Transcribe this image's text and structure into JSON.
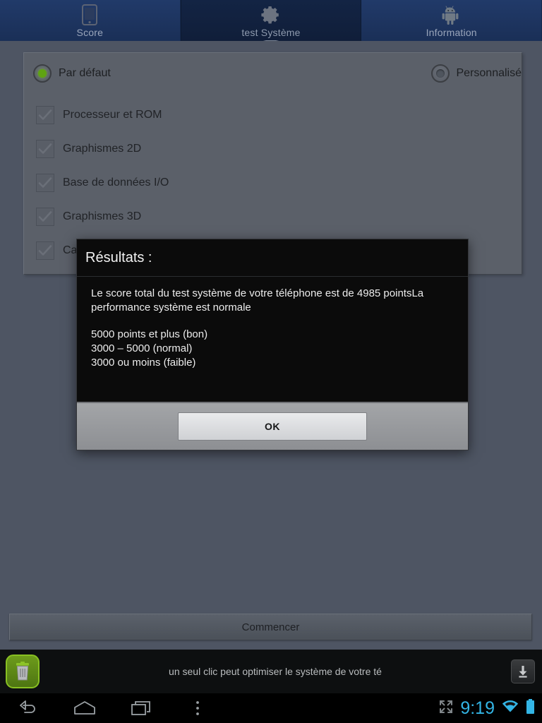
{
  "tabs": [
    {
      "label": "Score",
      "icon": "phone-icon",
      "selected": false
    },
    {
      "label": "test Système",
      "icon": "gear-icon",
      "selected": true
    },
    {
      "label": "Information",
      "icon": "android-icon",
      "selected": false
    }
  ],
  "panel": {
    "modes": [
      {
        "label": "Par défaut",
        "selected": true
      },
      {
        "label": "Personnalisé",
        "selected": false
      }
    ],
    "tests": [
      {
        "label": "Processeur et ROM",
        "checked": true,
        "enabled": false
      },
      {
        "label": "Graphismes 2D",
        "checked": true,
        "enabled": false
      },
      {
        "label": "Base de données I/O",
        "checked": true,
        "enabled": false
      },
      {
        "label": "Graphismes 3D",
        "checked": true,
        "enabled": false
      },
      {
        "label": "Carte SD I/O",
        "checked": true,
        "enabled": false
      }
    ]
  },
  "start_button": {
    "label": "Commencer"
  },
  "dialog": {
    "title": "Résultats :",
    "paragraph1": "Le score total du test système de votre téléphone est de 4985 pointsLa performance système est normale",
    "scale": [
      "5000 points et plus (bon)",
      "3000 – 5000 (normal)",
      "3000 ou moins (faible)"
    ],
    "ok_label": "OK",
    "score": 4985
  },
  "ad": {
    "text": "un seul clic peut optimiser le système de votre té",
    "icon": "trash-can-icon",
    "download_icon": "download-icon"
  },
  "navbar": {
    "back": "back-icon",
    "home": "home-icon",
    "recents": "recents-icon",
    "menu": "overflow-menu-icon",
    "fullscreen": "fullscreen-icon",
    "clock": "9:19",
    "wifi": "wifi-icon",
    "battery": "battery-icon"
  },
  "colors": {
    "accent_blue": "#33b5e5",
    "radio_green": "#5fa312",
    "tab_blue": "#213a69",
    "tab_selected": "#132444",
    "panel_gray": "#5b6069",
    "background": "#4e5563"
  }
}
